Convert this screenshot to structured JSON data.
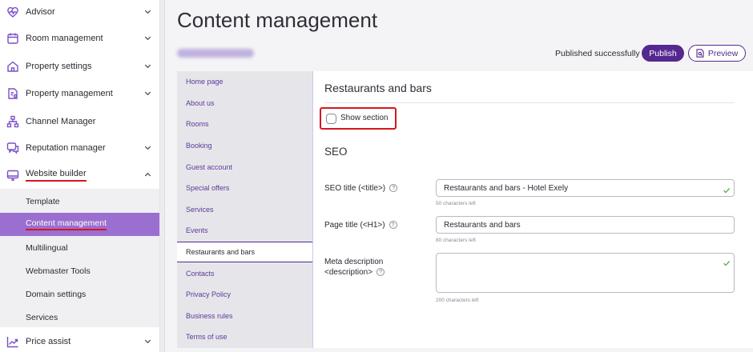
{
  "sidebar": {
    "items": [
      {
        "label": "Advisor",
        "icon": "heart-pulse-icon",
        "expandable": true
      },
      {
        "label": "Room management",
        "icon": "calendar-icon",
        "expandable": true
      },
      {
        "label": "Property settings",
        "icon": "home-icon",
        "expandable": true
      },
      {
        "label": "Property management",
        "icon": "document-settings-icon",
        "expandable": true
      },
      {
        "label": "Channel Manager",
        "icon": "sitemap-icon",
        "expandable": false
      },
      {
        "label": "Reputation manager",
        "icon": "chat-icon",
        "expandable": true
      },
      {
        "label": "Website builder",
        "icon": "monitor-icon",
        "expandable": true,
        "expanded": true
      },
      {
        "label": "Price assist",
        "icon": "trending-icon",
        "expandable": true
      }
    ],
    "sub_items": [
      {
        "label": "Template"
      },
      {
        "label": "Content management",
        "active": true
      },
      {
        "label": "Multilingual"
      },
      {
        "label": "Webmaster Tools"
      },
      {
        "label": "Domain settings"
      },
      {
        "label": "Services"
      }
    ]
  },
  "header": {
    "title": "Content management",
    "status": "Published successfully",
    "publish_label": "Publish",
    "preview_label": "Preview"
  },
  "sections": [
    "Home page",
    "About us",
    "Rooms",
    "Booking",
    "Guest account",
    "Special offers",
    "Services",
    "Events",
    "Restaurants and bars",
    "Contacts",
    "Privacy Policy",
    "Business rules",
    "Terms of use"
  ],
  "active_section": "Restaurants and bars",
  "panel": {
    "title": "Restaurants and bars",
    "show_section_label": "Show section",
    "show_section_checked": false,
    "seo_heading": "SEO",
    "seo_title_label": "SEO title (<title>)",
    "seo_title_value": "Restaurants and bars - Hotel Exely",
    "seo_title_hint": "50 characters left",
    "page_title_label": "Page title (<H1>)",
    "page_title_value": "Restaurants and bars",
    "page_title_hint": "80 characters left",
    "meta_label_line1": "Meta description",
    "meta_label_line2": "<description>",
    "meta_value": "",
    "meta_hint": "200 characters left",
    "help_glyph": "?"
  },
  "colors": {
    "accent": "#55288f",
    "active_sub_bg": "#9a6fd0",
    "highlight_red": "#d6161f",
    "valid_green": "#4caf50"
  }
}
